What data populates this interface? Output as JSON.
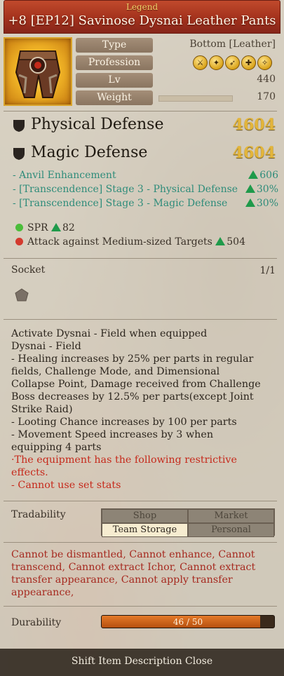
{
  "header": {
    "grade": "Legend",
    "title": "+8 [EP12] Savinose Dysnai Leather Pants"
  },
  "info": {
    "type_label": "Type",
    "type_value": "Bottom [Leather]",
    "profession_label": "Profession",
    "profession_icons": [
      "swordsman-class-icon",
      "wizard-class-icon",
      "archer-class-icon",
      "cleric-class-icon",
      "scout-class-icon"
    ],
    "lv_label": "Lv",
    "lv_value": "440",
    "weight_label": "Weight",
    "weight_value": "170"
  },
  "defense": {
    "physical_label": "Physical Defense",
    "physical_value": "4604",
    "magic_label": "Magic Defense",
    "magic_value": "4604"
  },
  "bonuses": [
    {
      "label": "- Anvil Enhancement",
      "value": "606"
    },
    {
      "label": "- [Transcendence] Stage 3 - Physical Defense",
      "value": "30%"
    },
    {
      "label": "- [Transcendence] Stage 3 - Magic Defense",
      "value": "30%"
    }
  ],
  "stats": [
    {
      "label": "SPR",
      "value": "82",
      "dot_color": "#4bbd3a"
    },
    {
      "label": "Attack against Medium-sized Targets",
      "value": "504",
      "dot_color": "#d33a2e"
    }
  ],
  "socket": {
    "label": "Socket",
    "count": "1/1"
  },
  "description": {
    "lines": [
      "Activate Dysnai - Field when equipped",
      "Dysnai - Field",
      "- Healing increases by 25% per parts in regular",
      "fields, Challenge Mode, and Dimensional",
      "Collapse Point, Damage received from Challenge",
      "Boss decreases by 12.5% per parts(except Joint",
      "Strike Raid)",
      "- Looting Chance increases by 100 per parts",
      "- Movement Speed increases by 3 when",
      "equipping 4 parts"
    ],
    "red_lines": [
      "·The equipment has the following restrictive",
      "effects.",
      "- Cannot use set stats"
    ]
  },
  "tradability": {
    "label": "Tradability",
    "shop": "Shop",
    "market": "Market",
    "team_storage": "Team Storage",
    "personal": "Personal"
  },
  "restrictions": {
    "lines": [
      "Cannot be dismantled, Cannot enhance, Cannot",
      "transcend, Cannot extract Ichor, Cannot extract",
      "transfer appearance, Cannot apply transfer",
      "appearance,"
    ]
  },
  "durability": {
    "label": "Durability",
    "text": "46 / 50",
    "fraction": 0.92
  },
  "footer": {
    "text": "Shift Item Description Close"
  },
  "colors": {
    "title_bar": "#a3311c",
    "grade_text": "#f5d36a",
    "defense_value": "#e3b53a",
    "bonus_text": "#2e8c7a",
    "up_arrow": "#1f9a4a",
    "restriction_text": "#a62a20",
    "durability_fill": "#d06a1f"
  }
}
